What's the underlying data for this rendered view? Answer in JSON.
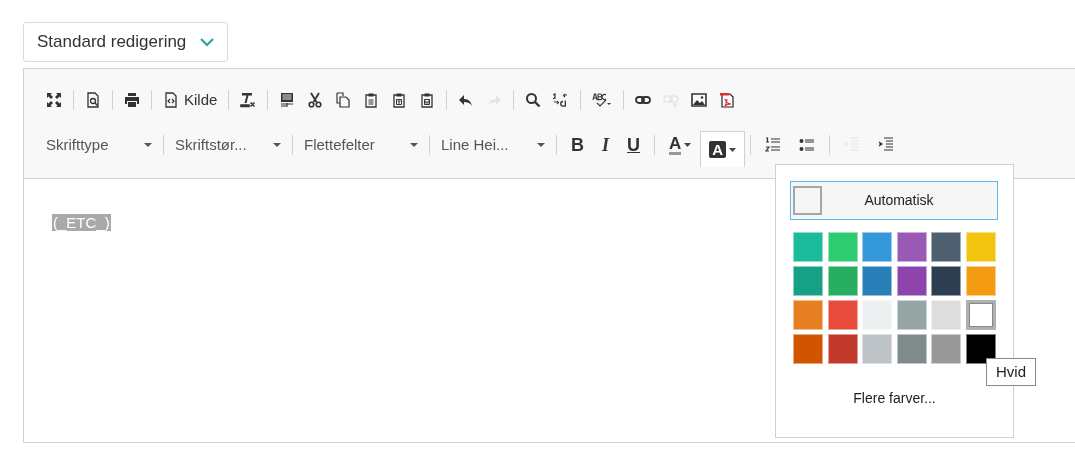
{
  "mode_select": {
    "value": "Standard redigering"
  },
  "toolbar": {
    "row1": [
      [
        {
          "disabled": false
        }
      ],
      [
        {
          "disabled": false
        }
      ],
      [
        {
          "disabled": false
        }
      ],
      [
        {
          "disabled": false,
          "label": "Kilde"
        }
      ],
      [
        {
          "disabled": false
        }
      ],
      [
        {
          "disabled": false
        },
        {
          "disabled": false
        },
        {
          "disabled": false
        },
        {
          "disabled": false
        },
        {
          "disabled": false
        },
        {
          "disabled": false
        }
      ],
      [
        {
          "disabled": false
        },
        {
          "disabled": true
        }
      ],
      [
        {
          "disabled": false
        },
        {
          "disabled": false
        }
      ],
      [
        {
          "disabled": false
        }
      ],
      [
        {
          "disabled": false
        },
        {
          "disabled": true
        },
        {
          "disabled": false
        },
        {
          "disabled": false
        }
      ]
    ],
    "combos": [
      {
        "label": "Skrifttype"
      },
      {
        "label": "Skriftstør..."
      },
      {
        "label": "Flettefelter"
      },
      {
        "label": "Line Hei..."
      }
    ],
    "row2": [
      [
        {
          "label": "B",
          "disabled": false,
          "active": false
        },
        {
          "label": "I",
          "disabled": false,
          "active": false
        },
        {
          "label": "U",
          "disabled": false,
          "active": false
        }
      ],
      [
        {
          "label": "A",
          "disabled": false,
          "active": false
        },
        {
          "label": "A",
          "disabled": false,
          "active": true
        }
      ],
      [
        {
          "disabled": false,
          "active": false
        },
        {
          "disabled": false,
          "active": false
        }
      ],
      [
        {
          "disabled": true,
          "active": false
        },
        {
          "disabled": false,
          "active": false
        }
      ]
    ]
  },
  "content": {
    "placeholder_field": "(_ETC_)"
  },
  "color_panel": {
    "automatic": "Automatisk",
    "swatches": [
      {
        "color": "#1abc9c",
        "selected": false
      },
      {
        "color": "#2ecc71",
        "selected": false
      },
      {
        "color": "#3498db",
        "selected": false
      },
      {
        "color": "#9b59b6",
        "selected": false
      },
      {
        "color": "#4e5f70",
        "selected": false
      },
      {
        "color": "#f1c40f",
        "selected": false
      },
      {
        "color": "#16a085",
        "selected": false
      },
      {
        "color": "#27ae60",
        "selected": false
      },
      {
        "color": "#2980b9",
        "selected": false
      },
      {
        "color": "#8e44ad",
        "selected": false
      },
      {
        "color": "#2c3e50",
        "selected": false
      },
      {
        "color": "#f39c12",
        "selected": false
      },
      {
        "color": "#e67e22",
        "selected": false
      },
      {
        "color": "#e74c3c",
        "selected": false
      },
      {
        "color": "#ecf0f1",
        "selected": false
      },
      {
        "color": "#95a5a6",
        "selected": false
      },
      {
        "color": "#dddddd",
        "selected": false
      },
      {
        "color": "#ffffff",
        "selected": true
      },
      {
        "color": "#d35400",
        "selected": false
      },
      {
        "color": "#c0392b",
        "selected": false
      },
      {
        "color": "#bdc3c7",
        "selected": false
      },
      {
        "color": "#7f8c8d",
        "selected": false
      },
      {
        "color": "#999999",
        "selected": false
      },
      {
        "color": "#000000",
        "selected": false
      }
    ],
    "tooltip": "Hvid",
    "more": "Flere farver..."
  }
}
